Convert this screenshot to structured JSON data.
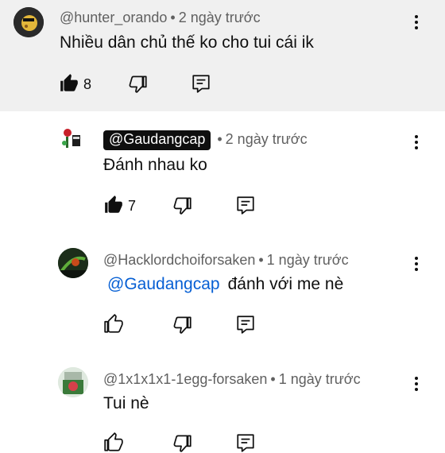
{
  "comments": [
    {
      "handle": "@hunter_orando",
      "time": "2 ngày trước",
      "text": "Nhiều dân chủ thế ko cho tui cái ik",
      "likes": "8",
      "liked": true,
      "avatar_colors": [
        "#1c1c1c",
        "#e3b73a"
      ]
    },
    {
      "handle": "@Gaudangcap",
      "time": "2 ngày trước",
      "text": "Đánh nhau ko",
      "likes": "7",
      "liked": true,
      "handle_highlight": true
    },
    {
      "handle": "@Hacklordchoiforsaken",
      "time": "1 ngày trước",
      "mention": "@Gaudangcap",
      "text": "đánh với me nè",
      "liked": false
    },
    {
      "handle": "@1x1x1x1-1egg-forsaken",
      "time": "1 ngày trước",
      "text": "Tui nè",
      "liked": false
    }
  ],
  "separator": "•",
  "colors": {
    "highlight_bg": "#f0f0f0",
    "mention": "#065fd4",
    "meta_text": "#606060",
    "text": "#0f0f0f"
  },
  "icons": [
    "like-icon",
    "dislike-icon",
    "reply-icon",
    "more-vert-icon"
  ]
}
